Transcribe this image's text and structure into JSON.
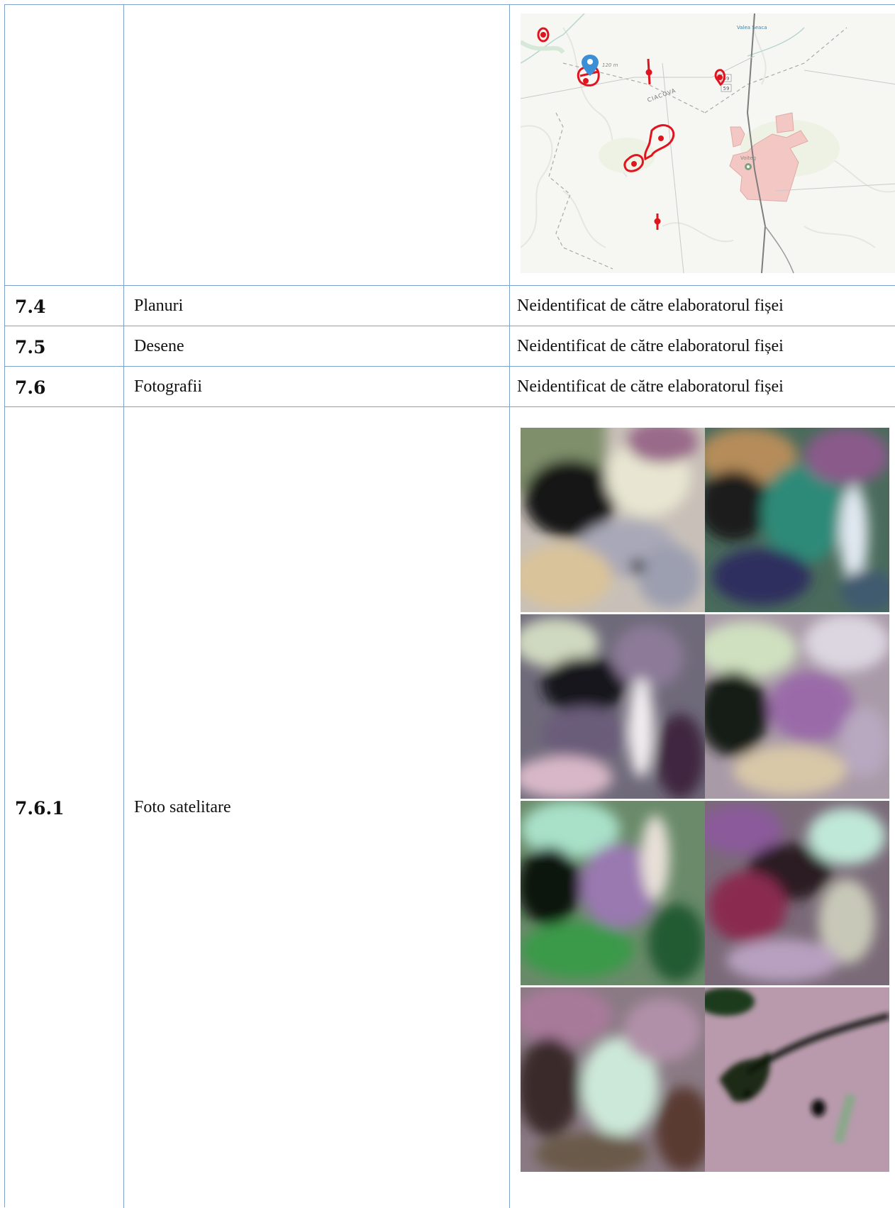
{
  "map": {
    "labels": {
      "valea_seaca": "Valea Seaca",
      "distance": "120 m",
      "ciacova": "CIACOVA",
      "voiteg": "Voiteg",
      "road_1": "59",
      "road_2": "59"
    }
  },
  "rows": [
    {
      "num": "7.4",
      "label": "Planuri",
      "value": "Neidentificat de către elaboratorul fișei"
    },
    {
      "num": "7.5",
      "label": "Desene",
      "value": "Neidentificat de către elaboratorul fișei"
    },
    {
      "num": "7.6",
      "label": "Fotografii",
      "value": "Neidentificat de către elaboratorul fișei"
    }
  ],
  "satellite_row": {
    "num": "7.6.1",
    "label": "Foto satelitare"
  },
  "colors": {
    "border": "#7ea1cc",
    "marker_red": "#e0141e",
    "pin_blue": "#3a8fd6",
    "built_area": "#f3c8c4"
  }
}
